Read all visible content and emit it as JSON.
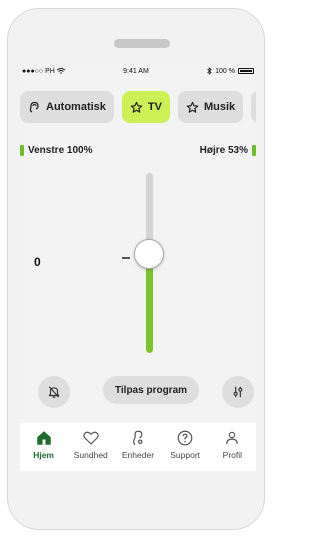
{
  "status_bar": {
    "carrier": "●●●○○ PH",
    "wifi_icon": "wifi-icon",
    "time": "9:41 AM",
    "bluetooth_icon": "bluetooth-icon",
    "battery": "100 %"
  },
  "programs": {
    "items": [
      {
        "label": "Automatisk",
        "icon": "ear-icon",
        "active": false
      },
      {
        "label": "TV",
        "icon": "star-icon",
        "active": true
      },
      {
        "label": "Musik",
        "icon": "star-icon",
        "active": false
      }
    ]
  },
  "hearing_aids": {
    "left_label": "Venstre 100%",
    "right_label": "Højre 53%",
    "battery_color": "#6dbd2d"
  },
  "volume": {
    "value": "0",
    "level_fraction": 0.55
  },
  "controls": {
    "mute_icon": "mute-icon",
    "tune_label": "Tilpas program",
    "equalizer_icon": "equalizer-icon"
  },
  "tabbar": {
    "items": [
      {
        "label": "Hjem",
        "icon": "home-icon",
        "active": true
      },
      {
        "label": "Sundhed",
        "icon": "heart-icon",
        "active": false
      },
      {
        "label": "Enheder",
        "icon": "hearing-aid-icon",
        "active": false
      },
      {
        "label": "Support",
        "icon": "help-icon",
        "active": false
      },
      {
        "label": "Profil",
        "icon": "profile-icon",
        "active": false
      }
    ]
  },
  "colors": {
    "accent": "#cdf056",
    "slider_fill": "#7cc42c",
    "active_tab": "#1f6b30"
  }
}
